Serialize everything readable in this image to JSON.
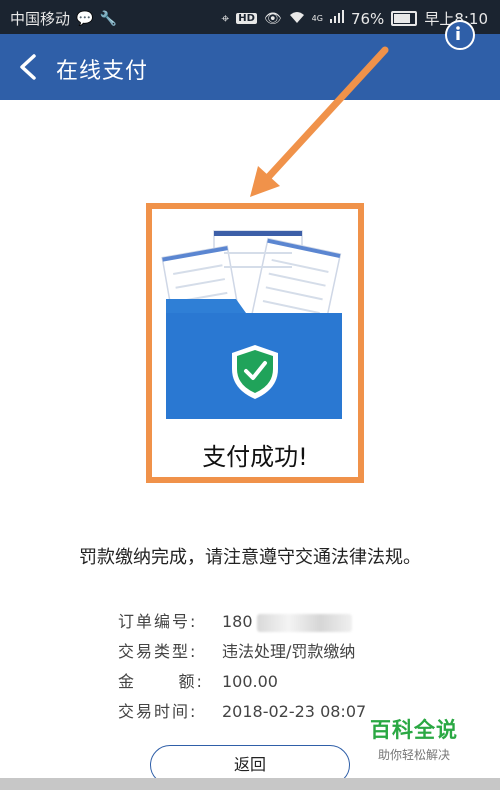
{
  "status_bar": {
    "carrier": "中国移动",
    "hd_badge": "HD",
    "network": "4G",
    "battery_percent": "76%",
    "time": "早上8:10"
  },
  "header": {
    "title": "在线支付",
    "background_color": "#2f5fa8"
  },
  "result": {
    "title": "支付成功!",
    "message": "罚款缴纳完成，请注意遵守交通法律法规。"
  },
  "details": [
    {
      "label": "订单编号:",
      "value": "180"
    },
    {
      "label": "交易类型:",
      "value": "违法处理/罚款缴纳"
    },
    {
      "label": "金      额:",
      "value": "100.00"
    },
    {
      "label": "交易时间:",
      "value": "2018-02-23 08:07"
    }
  ],
  "actions": {
    "return_label": "返回"
  },
  "watermark": {
    "main": "百科全说",
    "sub": "助你轻松解决"
  },
  "annotation": {
    "highlight_color": "#f0924a"
  },
  "icons": [
    "back-icon",
    "info-icon",
    "folder-shield-icon",
    "annotation-arrow-icon"
  ]
}
